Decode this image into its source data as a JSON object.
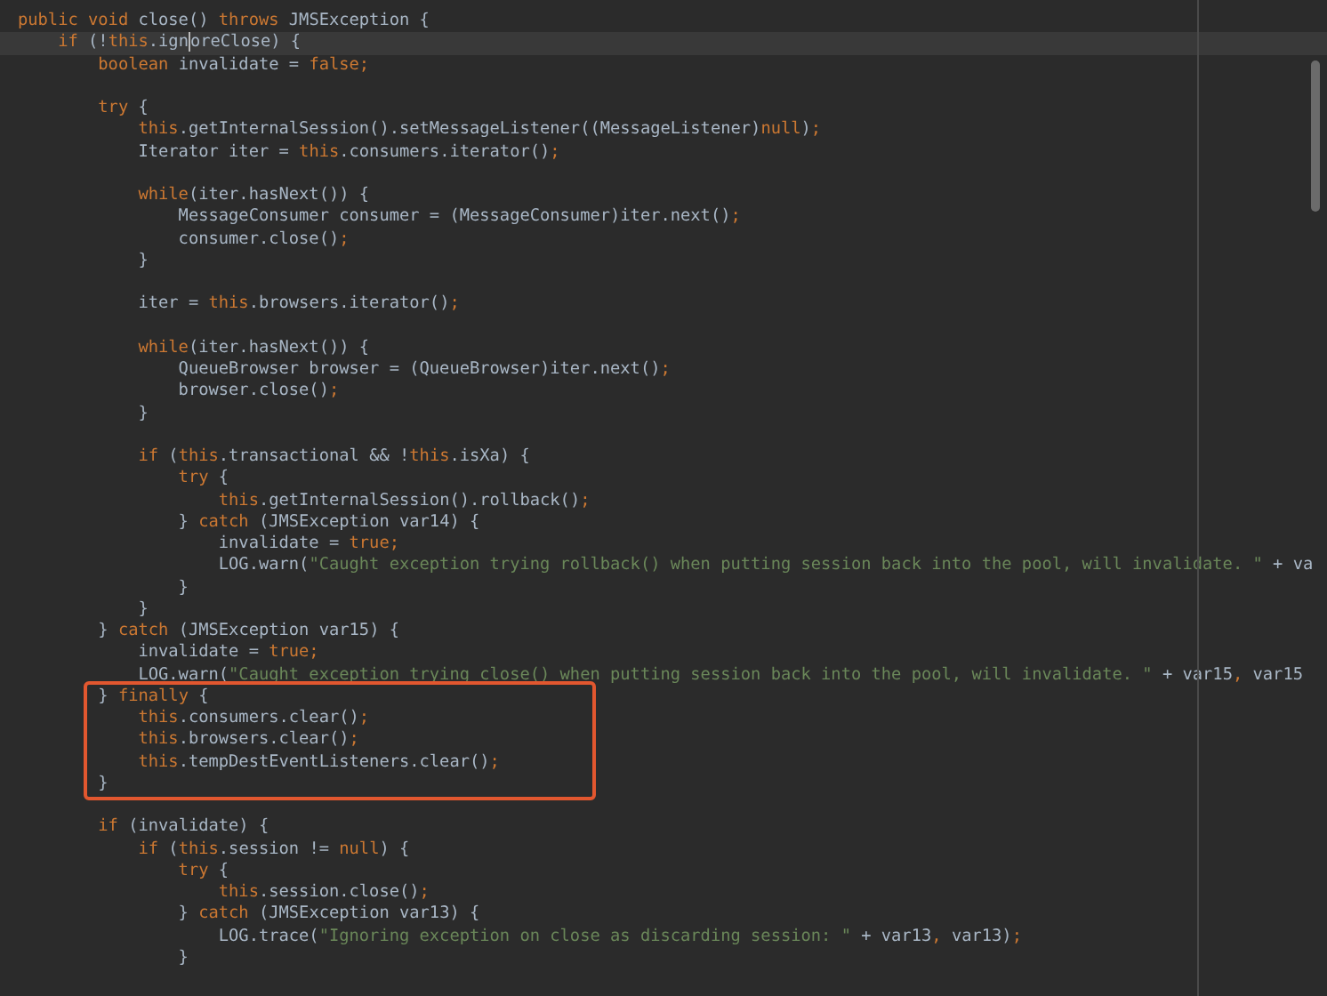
{
  "editor": {
    "lines": [
      {
        "current": false,
        "boxed": false,
        "tokens": [
          {
            "kind": "keyword",
            "text": "public void "
          },
          {
            "kind": "plain",
            "text": "close() "
          },
          {
            "kind": "keyword",
            "text": "throws "
          },
          {
            "kind": "plain",
            "text": "JMSException {"
          }
        ]
      },
      {
        "current": true,
        "boxed": false,
        "tokens": [
          {
            "kind": "keyword",
            "text": "    if "
          },
          {
            "kind": "plain",
            "text": "(!"
          },
          {
            "kind": "keyword",
            "text": "this"
          },
          {
            "kind": "plain",
            "text": ".ign"
          },
          {
            "kind": "plain",
            "text": "oreClose) {",
            "caret": true
          }
        ]
      },
      {
        "current": false,
        "boxed": false,
        "tokens": [
          {
            "kind": "keyword",
            "text": "        boolean "
          },
          {
            "kind": "plain",
            "text": "invalidate = "
          },
          {
            "kind": "keyword",
            "text": "false;"
          }
        ]
      },
      {
        "current": false,
        "boxed": false
      },
      {
        "current": false,
        "boxed": false,
        "tokens": [
          {
            "kind": "keyword",
            "text": "        try "
          },
          {
            "kind": "plain",
            "text": "{"
          }
        ]
      },
      {
        "current": false,
        "boxed": false,
        "tokens": [
          {
            "kind": "keyword",
            "text": "            this"
          },
          {
            "kind": "plain",
            "text": ".getInternalSession().setMessageListener((MessageListener)"
          },
          {
            "kind": "keyword",
            "text": "null"
          },
          {
            "kind": "plain",
            "text": ")"
          },
          {
            "kind": "keyword",
            "text": ";"
          }
        ]
      },
      {
        "current": false,
        "boxed": false,
        "tokens": [
          {
            "kind": "plain",
            "text": "            Iterator iter = "
          },
          {
            "kind": "keyword",
            "text": "this"
          },
          {
            "kind": "plain",
            "text": ".consumers.iterator()"
          },
          {
            "kind": "keyword",
            "text": ";"
          }
        ]
      },
      {
        "current": false,
        "boxed": false
      },
      {
        "current": false,
        "boxed": false,
        "tokens": [
          {
            "kind": "keyword",
            "text": "            while"
          },
          {
            "kind": "plain",
            "text": "(iter.hasNext()) {"
          }
        ]
      },
      {
        "current": false,
        "boxed": false,
        "tokens": [
          {
            "kind": "plain",
            "text": "                MessageConsumer consumer = (MessageConsumer)iter.next()"
          },
          {
            "kind": "keyword",
            "text": ";"
          }
        ]
      },
      {
        "current": false,
        "boxed": false,
        "tokens": [
          {
            "kind": "plain",
            "text": "                consumer.close()"
          },
          {
            "kind": "keyword",
            "text": ";"
          }
        ]
      },
      {
        "current": false,
        "boxed": false,
        "tokens": [
          {
            "kind": "plain",
            "text": "            }"
          }
        ]
      },
      {
        "current": false,
        "boxed": false
      },
      {
        "current": false,
        "boxed": false,
        "tokens": [
          {
            "kind": "plain",
            "text": "            iter = "
          },
          {
            "kind": "keyword",
            "text": "this"
          },
          {
            "kind": "plain",
            "text": ".browsers.iterator()"
          },
          {
            "kind": "keyword",
            "text": ";"
          }
        ]
      },
      {
        "current": false,
        "boxed": false
      },
      {
        "current": false,
        "boxed": false,
        "tokens": [
          {
            "kind": "keyword",
            "text": "            while"
          },
          {
            "kind": "plain",
            "text": "(iter.hasNext()) {"
          }
        ]
      },
      {
        "current": false,
        "boxed": false,
        "tokens": [
          {
            "kind": "plain",
            "text": "                QueueBrowser browser = (QueueBrowser)iter.next()"
          },
          {
            "kind": "keyword",
            "text": ";"
          }
        ]
      },
      {
        "current": false,
        "boxed": false,
        "tokens": [
          {
            "kind": "plain",
            "text": "                browser.close()"
          },
          {
            "kind": "keyword",
            "text": ";"
          }
        ]
      },
      {
        "current": false,
        "boxed": false,
        "tokens": [
          {
            "kind": "plain",
            "text": "            }"
          }
        ]
      },
      {
        "current": false,
        "boxed": false
      },
      {
        "current": false,
        "boxed": false,
        "tokens": [
          {
            "kind": "keyword",
            "text": "            if "
          },
          {
            "kind": "plain",
            "text": "("
          },
          {
            "kind": "keyword",
            "text": "this"
          },
          {
            "kind": "plain",
            "text": ".transactional && !"
          },
          {
            "kind": "keyword",
            "text": "this"
          },
          {
            "kind": "plain",
            "text": ".isXa) {"
          }
        ]
      },
      {
        "current": false,
        "boxed": false,
        "tokens": [
          {
            "kind": "keyword",
            "text": "                try "
          },
          {
            "kind": "plain",
            "text": "{"
          }
        ]
      },
      {
        "current": false,
        "boxed": false,
        "tokens": [
          {
            "kind": "keyword",
            "text": "                    this"
          },
          {
            "kind": "plain",
            "text": ".getInternalSession().rollback()"
          },
          {
            "kind": "keyword",
            "text": ";"
          }
        ]
      },
      {
        "current": false,
        "boxed": false,
        "tokens": [
          {
            "kind": "plain",
            "text": "                } "
          },
          {
            "kind": "keyword",
            "text": "catch "
          },
          {
            "kind": "plain",
            "text": "(JMSException var14) {"
          }
        ]
      },
      {
        "current": false,
        "boxed": false,
        "tokens": [
          {
            "kind": "plain",
            "text": "                    invalidate = "
          },
          {
            "kind": "keyword",
            "text": "true;"
          }
        ]
      },
      {
        "current": false,
        "boxed": false,
        "tokens": [
          {
            "kind": "plain",
            "text": "                    LOG.warn("
          },
          {
            "kind": "string",
            "text": "\"Caught exception trying rollback() when putting session back into the pool, will invalidate. \""
          },
          {
            "kind": "plain",
            "text": " + va"
          }
        ]
      },
      {
        "current": false,
        "boxed": false,
        "tokens": [
          {
            "kind": "plain",
            "text": "                }"
          }
        ]
      },
      {
        "current": false,
        "boxed": false,
        "tokens": [
          {
            "kind": "plain",
            "text": "            }"
          }
        ]
      },
      {
        "current": false,
        "boxed": false,
        "tokens": [
          {
            "kind": "plain",
            "text": "        } "
          },
          {
            "kind": "keyword",
            "text": "catch "
          },
          {
            "kind": "plain",
            "text": "(JMSException var15) {"
          }
        ]
      },
      {
        "current": false,
        "boxed": false,
        "tokens": [
          {
            "kind": "plain",
            "text": "            invalidate = "
          },
          {
            "kind": "keyword",
            "text": "true;"
          }
        ]
      },
      {
        "current": false,
        "boxed": false,
        "tokens": [
          {
            "kind": "plain",
            "text": "            LOG.warn("
          },
          {
            "kind": "string",
            "text": "\"Caught exception trying close() when putting session back into the pool, will invalidate. \""
          },
          {
            "kind": "plain",
            "text": " + var15"
          },
          {
            "kind": "keyword",
            "text": ", "
          },
          {
            "kind": "plain",
            "text": "var15"
          }
        ]
      },
      {
        "current": false,
        "boxed": true,
        "tokens": [
          {
            "kind": "plain",
            "text": "        } "
          },
          {
            "kind": "keyword",
            "text": "finally "
          },
          {
            "kind": "plain",
            "text": "{"
          }
        ]
      },
      {
        "current": false,
        "boxed": true,
        "tokens": [
          {
            "kind": "keyword",
            "text": "            this"
          },
          {
            "kind": "plain",
            "text": ".consumers.clear()"
          },
          {
            "kind": "keyword",
            "text": ";"
          }
        ]
      },
      {
        "current": false,
        "boxed": true,
        "tokens": [
          {
            "kind": "keyword",
            "text": "            this"
          },
          {
            "kind": "plain",
            "text": ".browsers.clear()"
          },
          {
            "kind": "keyword",
            "text": ";"
          }
        ]
      },
      {
        "current": false,
        "boxed": true,
        "tokens": [
          {
            "kind": "keyword",
            "text": "            this"
          },
          {
            "kind": "plain",
            "text": ".tempDestEventListeners.clear()"
          },
          {
            "kind": "keyword",
            "text": ";"
          }
        ]
      },
      {
        "current": false,
        "boxed": true,
        "tokens": [
          {
            "kind": "plain",
            "text": "        }"
          }
        ]
      },
      {
        "current": false,
        "boxed": false
      },
      {
        "current": false,
        "boxed": false,
        "tokens": [
          {
            "kind": "keyword",
            "text": "        if "
          },
          {
            "kind": "plain",
            "text": "(invalidate) {"
          }
        ]
      },
      {
        "current": false,
        "boxed": false,
        "tokens": [
          {
            "kind": "keyword",
            "text": "            if "
          },
          {
            "kind": "plain",
            "text": "("
          },
          {
            "kind": "keyword",
            "text": "this"
          },
          {
            "kind": "plain",
            "text": ".session != "
          },
          {
            "kind": "keyword",
            "text": "null"
          },
          {
            "kind": "plain",
            "text": ") {"
          }
        ]
      },
      {
        "current": false,
        "boxed": false,
        "tokens": [
          {
            "kind": "keyword",
            "text": "                try "
          },
          {
            "kind": "plain",
            "text": "{"
          }
        ]
      },
      {
        "current": false,
        "boxed": false,
        "tokens": [
          {
            "kind": "keyword",
            "text": "                    this"
          },
          {
            "kind": "plain",
            "text": ".session.close()"
          },
          {
            "kind": "keyword",
            "text": ";"
          }
        ]
      },
      {
        "current": false,
        "boxed": false,
        "tokens": [
          {
            "kind": "plain",
            "text": "                } "
          },
          {
            "kind": "keyword",
            "text": "catch "
          },
          {
            "kind": "plain",
            "text": "(JMSException var13) {"
          }
        ]
      },
      {
        "current": false,
        "boxed": false,
        "tokens": [
          {
            "kind": "plain",
            "text": "                    LOG.trace("
          },
          {
            "kind": "string",
            "text": "\"Ignoring exception on close as discarding session: \""
          },
          {
            "kind": "plain",
            "text": " + var13"
          },
          {
            "kind": "keyword",
            "text": ", "
          },
          {
            "kind": "plain",
            "text": "var13)"
          },
          {
            "kind": "keyword",
            "text": ";"
          }
        ]
      },
      {
        "current": false,
        "boxed": false,
        "tokens": [
          {
            "kind": "plain",
            "text": "                }"
          }
        ]
      }
    ]
  }
}
